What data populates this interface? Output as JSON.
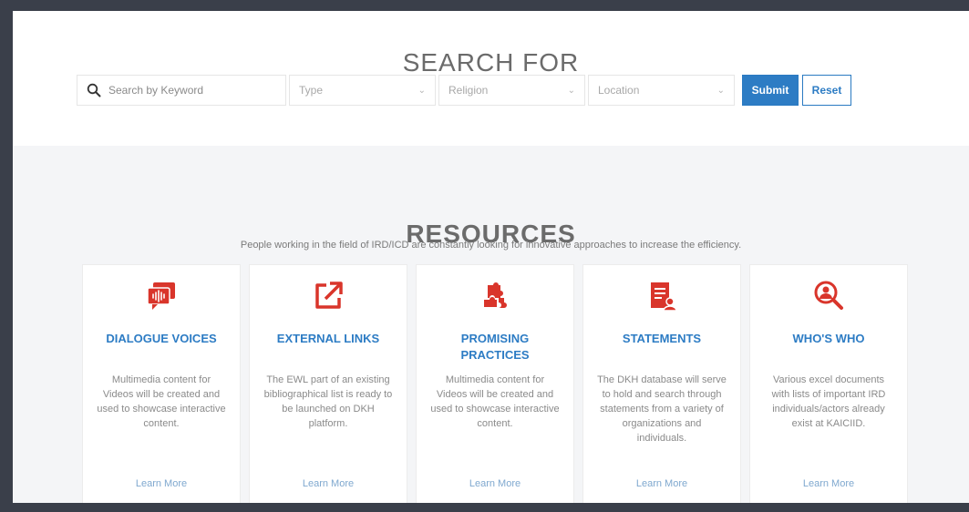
{
  "search": {
    "title": "SEARCH FOR",
    "keyword_placeholder": "Search by Keyword",
    "type_label": "Type",
    "religion_label": "Religion",
    "location_label": "Location",
    "submit_label": "Submit",
    "reset_label": "Reset"
  },
  "resources": {
    "title": "RESOURCES",
    "subtitle": "People working in the field of IRD/ICD are constantly looking for innovative approaches to increase the efficiency.",
    "cards": [
      {
        "icon": "audio-chat-icon",
        "title": "DIALOGUE VOICES",
        "description": "Multimedia content for Videos will be created and used to showcase interactive content.",
        "link": "Learn More"
      },
      {
        "icon": "external-link-icon",
        "title": "EXTERNAL LINKS",
        "description": "The EWL part of an existing bibliographical list is ready to be launched on DKH platform.",
        "link": "Learn More"
      },
      {
        "icon": "puzzle-icon",
        "title": "PROMISING PRACTICES",
        "description": "Multimedia content for Videos will be created and used to showcase interactive content.",
        "link": "Learn More"
      },
      {
        "icon": "document-user-icon",
        "title": "STATEMENTS",
        "description": "The DKH database will serve to hold and search through statements from a variety of organizations and individuals.",
        "link": "Learn More"
      },
      {
        "icon": "search-person-icon",
        "title": "WHO'S WHO",
        "description": "Various excel documents with lists of important IRD individuals/actors already exist at KAICIID.",
        "link": "Learn More"
      }
    ]
  },
  "colors": {
    "accent": "#2d7cc4",
    "icon_red": "#d9352b",
    "section_bg": "#f4f5f7"
  }
}
